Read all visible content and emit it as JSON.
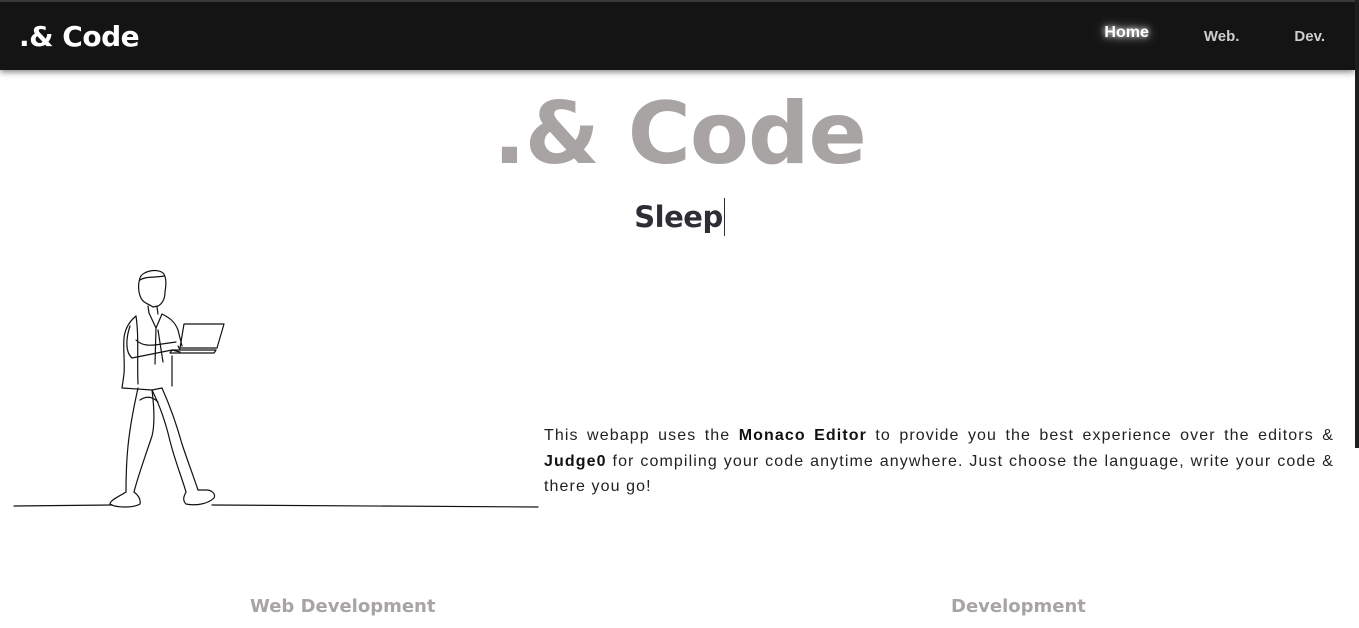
{
  "navbar": {
    "brand": ".& Code",
    "links": [
      {
        "label": "Home",
        "active": true
      },
      {
        "label": "Web.",
        "active": false
      },
      {
        "label": "Dev.",
        "active": false
      }
    ]
  },
  "hero": {
    "title": ".& Code",
    "typed_text": "Sleep"
  },
  "description": {
    "part1": "This webapp uses the ",
    "editor": "Monaco Editor",
    "part2": " to provide you the best experience over the editors & ",
    "compiler": "Judge0",
    "part3": " for compiling your code anytime anywhere. Just choose the language, write your code & there you go!"
  },
  "sections": {
    "web": "Web Development",
    "dev": "Development"
  },
  "colors": {
    "navbar_bg": "#141414",
    "hero_title": "#a8a4a4",
    "typed_text": "#2e2e36"
  },
  "icons": {
    "illustration": "man-walking-with-laptop-line-art"
  }
}
